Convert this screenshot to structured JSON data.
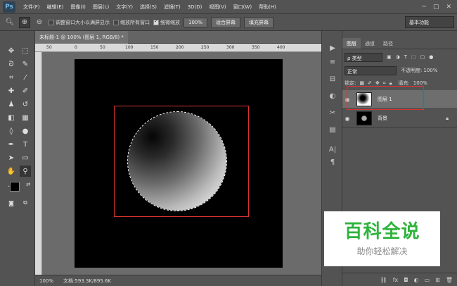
{
  "app": {
    "logo": "Ps"
  },
  "menu": [
    "文件(F)",
    "编辑(E)",
    "图像(I)",
    "图层(L)",
    "文字(Y)",
    "选择(S)",
    "滤镜(T)",
    "3D(D)",
    "视图(V)",
    "窗口(W)",
    "帮助(H)"
  ],
  "options": {
    "resize_windows": "调整窗口大小以满屏显示",
    "zoom_all": "缩放所有窗口",
    "scrubby_zoom": "细微缩放",
    "zoom_value": "100%",
    "fit_screen": "适合屏幕",
    "fill_screen": "填充屏幕",
    "workspace": "基本功能"
  },
  "document": {
    "tab_title": "未标题-1 @ 100% (图层 1, RGB/8) *",
    "ruler_ticks": [
      "50",
      "0",
      "50",
      "100",
      "150",
      "200",
      "250",
      "300",
      "350",
      "400"
    ],
    "zoom": "100%",
    "doc_size": "文档:593.3K/895.6K"
  },
  "layers_panel": {
    "tabs": [
      "图层",
      "通道",
      "路径"
    ],
    "kind_filter": "ρ 类型",
    "blend_mode": "正常",
    "opacity_label": "不透明度:",
    "opacity_value": "100%",
    "lock_label": "锁定:",
    "fill_label": "填充:",
    "fill_value": "100%",
    "layers": [
      {
        "name": "图层 1",
        "selected": true
      },
      {
        "name": "背景",
        "locked": true
      }
    ]
  },
  "watermark": {
    "title": "百科全说",
    "subtitle": "助你轻松解决"
  },
  "colors": {
    "accent_selection": "#dd3333",
    "watermark_green": "#2fb33d"
  }
}
